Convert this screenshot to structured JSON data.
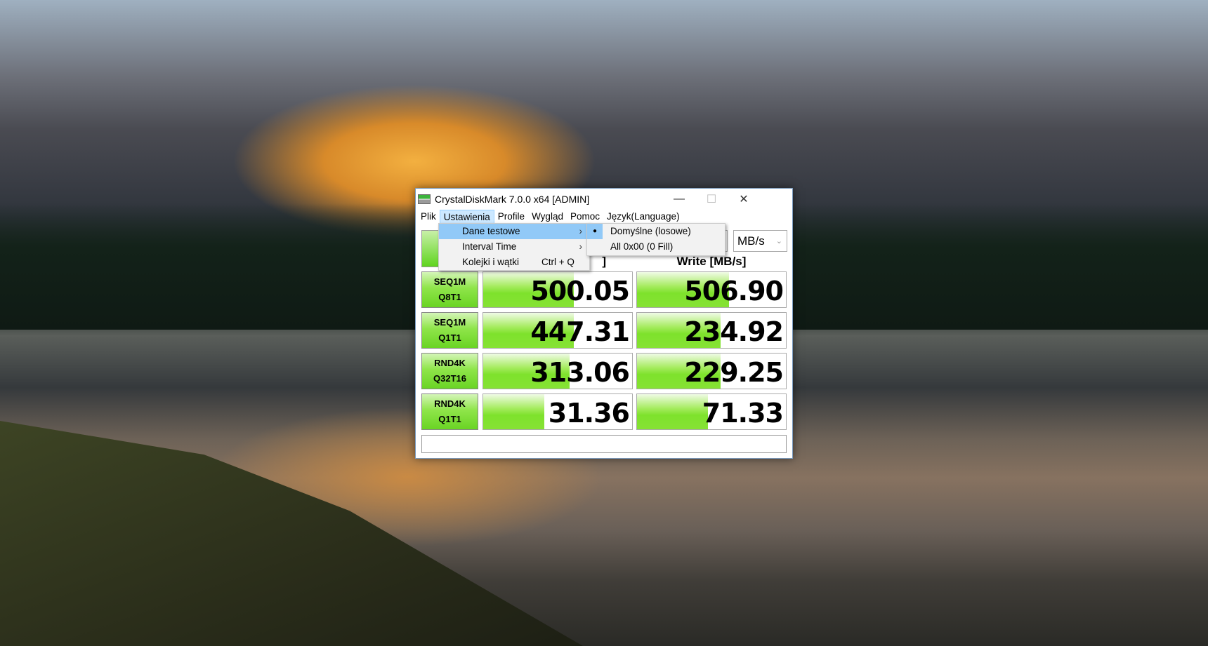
{
  "window": {
    "title": "CrystalDiskMark 7.0.0 x64 [ADMIN]",
    "minimize": "—",
    "maximize": "☐",
    "close": "✕"
  },
  "menubar": [
    "Plik",
    "Ustawienia",
    "Profile",
    "Wygląd",
    "Pomoc",
    "Język(Language)"
  ],
  "menu_ustawienia": [
    {
      "label": "Dane testowe",
      "arrow": "›"
    },
    {
      "label": "Interval Time",
      "arrow": "›"
    },
    {
      "label": "Kolejki i wątki",
      "shortcut": "Ctrl + Q"
    }
  ],
  "submenu_dane": [
    {
      "label": "Domyślne (losowe)",
      "bullet": "●",
      "selected": true
    },
    {
      "label": "All 0x00 (0 Fill)"
    }
  ],
  "unit": {
    "value": "MB/s",
    "chevron": "⌄"
  },
  "headers": {
    "read": "Read [MB/s]",
    "write": "Write [MB/s]",
    "read_visible": "]"
  },
  "results": [
    {
      "l1": "SEQ1M",
      "l2": "Q8T1",
      "read": "500.05",
      "write": "506.90",
      "read_fill": 61,
      "write_fill": 62
    },
    {
      "l1": "SEQ1M",
      "l2": "Q1T1",
      "read": "447.31",
      "write": "234.92",
      "read_fill": 61,
      "write_fill": 56
    },
    {
      "l1": "RND4K",
      "l2": "Q32T16",
      "read": "313.06",
      "write": "229.25",
      "read_fill": 58,
      "write_fill": 56
    },
    {
      "l1": "RND4K",
      "l2": "Q1T1",
      "read": "31.36",
      "write": "71.33",
      "read_fill": 41,
      "write_fill": 47.5
    }
  ],
  "colors": {
    "accent": "#7ee22c",
    "menu_highlight": "#91c9f7"
  }
}
